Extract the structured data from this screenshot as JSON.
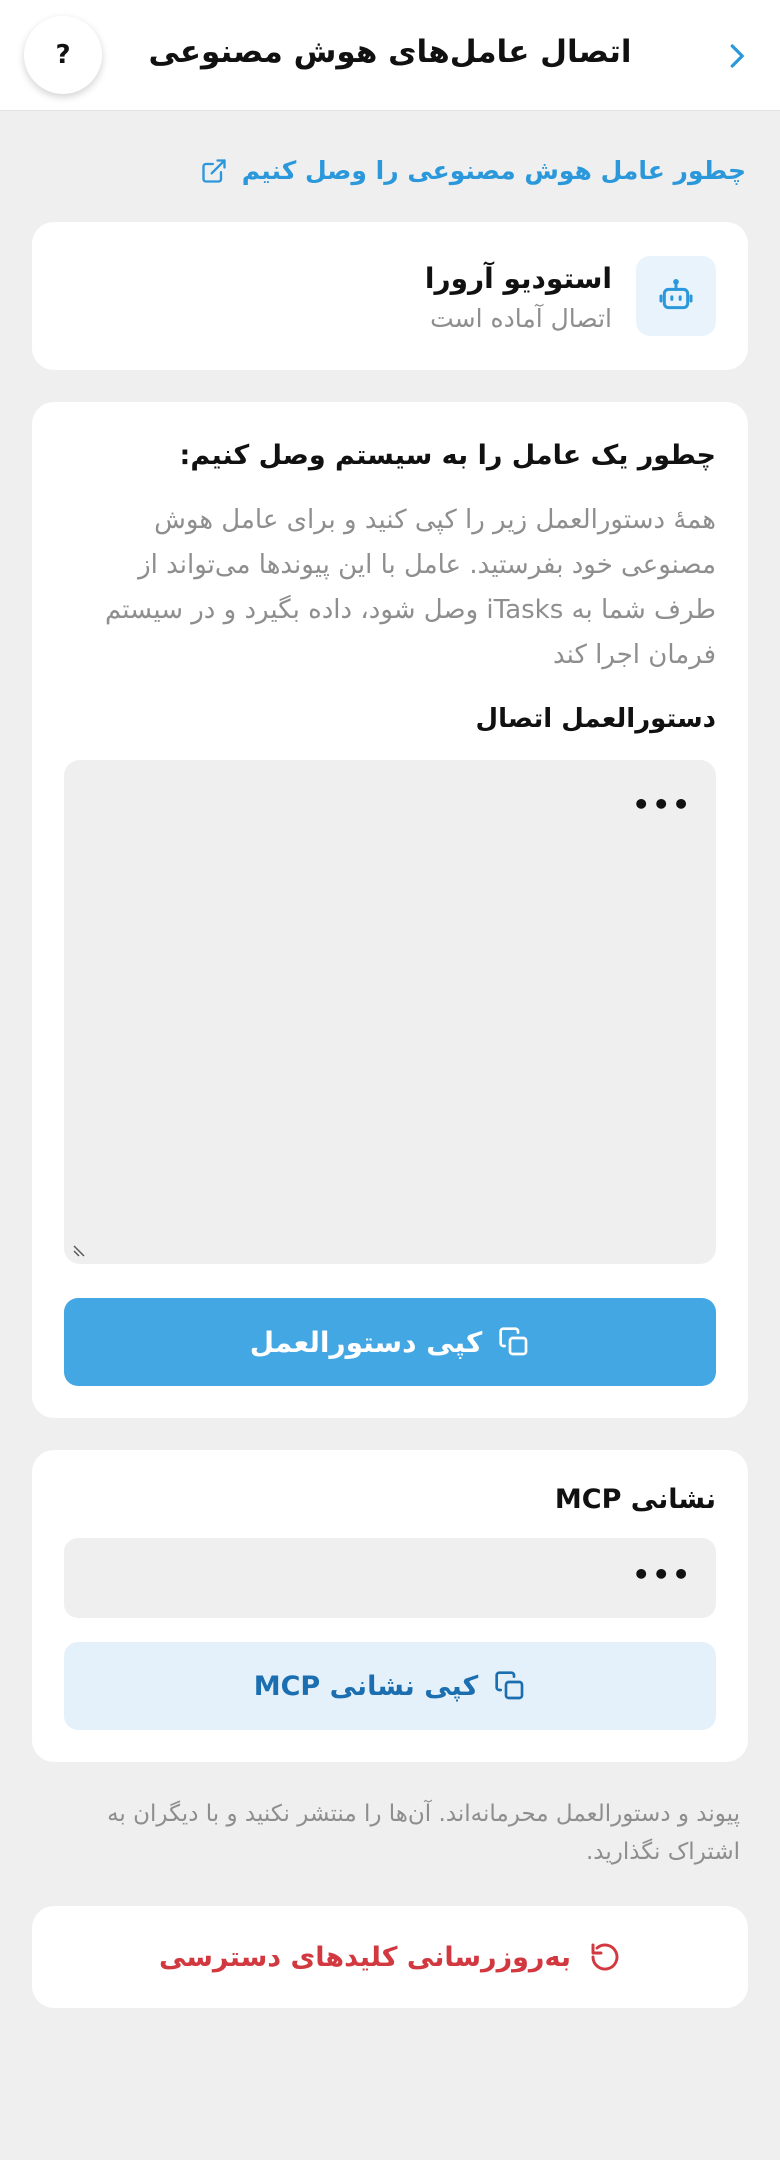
{
  "header": {
    "title": "اتصال عامل‌های هوش مصنوعی",
    "help_label": "?"
  },
  "howto_link": {
    "label": "چطور عامل هوش مصنوعی را وصل کنیم"
  },
  "agent": {
    "name": "استودیو آرورا",
    "status": "اتصال آماده است"
  },
  "instructions": {
    "heading": "چطور یک عامل را به سیستم وصل کنیم:",
    "description": "همهٔ دستورالعمل زیر را کپی کنید و برای عامل هوش مصنوعی خود بفرستید. عامل با این پیوندها می‌تواند از طرف شما به iTasks وصل شود، داده بگیرد و در سیستم فرمان اجرا کند",
    "field_label": "دستورالعمل اتصال",
    "field_value": "•••",
    "copy_button": "کپی دستورالعمل"
  },
  "mcp": {
    "label": "نشانی MCP",
    "field_value": "•••",
    "copy_button": "کپی نشانی MCP"
  },
  "warning": "پیوند و دستورالعمل محرمانه‌اند. آن‌ها را منتشر نکنید و با دیگران به اشتراک نگذارید.",
  "refresh_button": "به‌روزرسانی کلیدهای دسترسی",
  "colors": {
    "accent": "#42a7e3",
    "link": "#2b98db",
    "danger": "#d2383f",
    "background": "#efefef"
  },
  "icons": {
    "back": "chevron-right-icon",
    "link": "external-link-icon",
    "agent": "robot-icon",
    "copy": "copy-icon",
    "refresh": "refresh-icon"
  }
}
